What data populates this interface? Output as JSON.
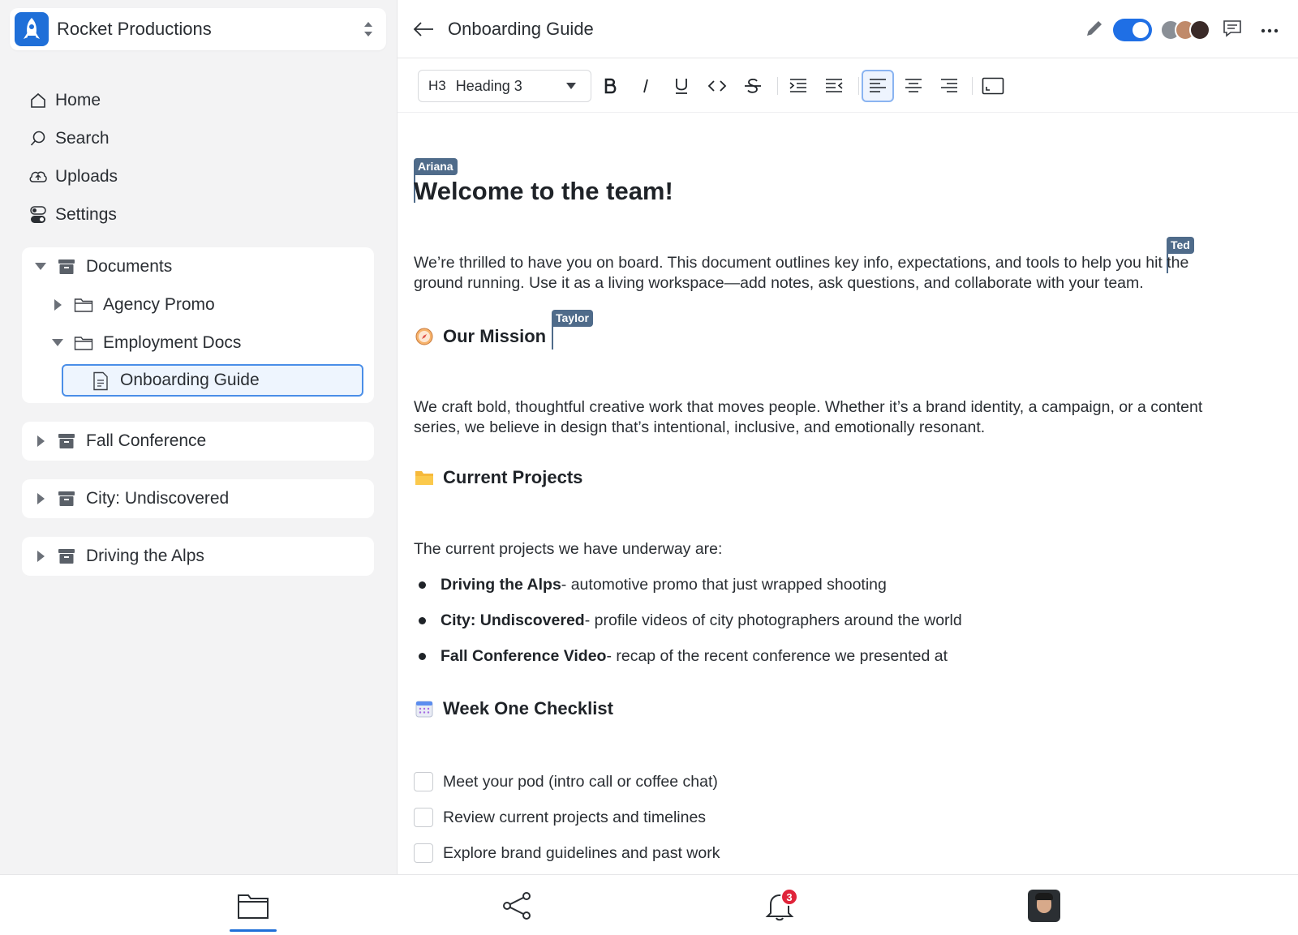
{
  "workspace": {
    "name": "Rocket Productions"
  },
  "nav": [
    {
      "label": "Home",
      "icon": "home-icon"
    },
    {
      "label": "Search",
      "icon": "search-icon"
    },
    {
      "label": "Uploads",
      "icon": "cloud-upload-icon"
    },
    {
      "label": "Settings",
      "icon": "toggles-icon"
    }
  ],
  "tree": {
    "documents": "Documents",
    "agency_promo": "Agency Promo",
    "employment_docs": "Employment Docs",
    "onboarding_guide": "Onboarding Guide",
    "fall_conference": "Fall Conference",
    "city_undiscovered": "City: Undiscovered",
    "driving_alps": "Driving the Alps"
  },
  "header": {
    "title": "Onboarding Guide"
  },
  "toolbar": {
    "style_prefix": "H3",
    "style_label": "Heading 3"
  },
  "cursors": {
    "ariana": "Ariana",
    "ted": "Ted",
    "taylor": "Taylor"
  },
  "doc": {
    "title": "Welcome to the team!",
    "intro_line1": "We’re thrilled to have you on board. This document outlines key info, expectations, and tools to help you hit the",
    "intro_line2": "ground running. Use it as a living workspace—add notes, ask questions, and collaborate with your team.",
    "mission_heading": "Our Mission",
    "mission_line1": "We craft bold, thoughtful creative work that moves people. Whether it’s a brand identity, a campaign, or a content",
    "mission_line2": "series, we believe in design that’s intentional, inclusive, and emotionally resonant.",
    "projects_heading": "Current Projects",
    "projects_intro": "The current projects we have underway are:",
    "projects": [
      {
        "name": "Driving the Alps",
        "desc": " - automotive promo that just wrapped shooting"
      },
      {
        "name": "City: Undiscovered",
        "desc": " - profile videos of city photographers around the world"
      },
      {
        "name": "Fall Conference Video",
        "desc": " - recap of the recent conference we presented at"
      }
    ],
    "checklist_heading": "Week One Checklist",
    "checklist": [
      "Meet your pod (intro call or coffee chat)",
      "Review current projects and timelines",
      "Explore brand guidelines and past work"
    ]
  },
  "notifications": {
    "count": "3"
  },
  "colors": {
    "accent": "#1f6fd8",
    "cursor_tag": "#4f6b8a",
    "badge": "#e0243a"
  }
}
